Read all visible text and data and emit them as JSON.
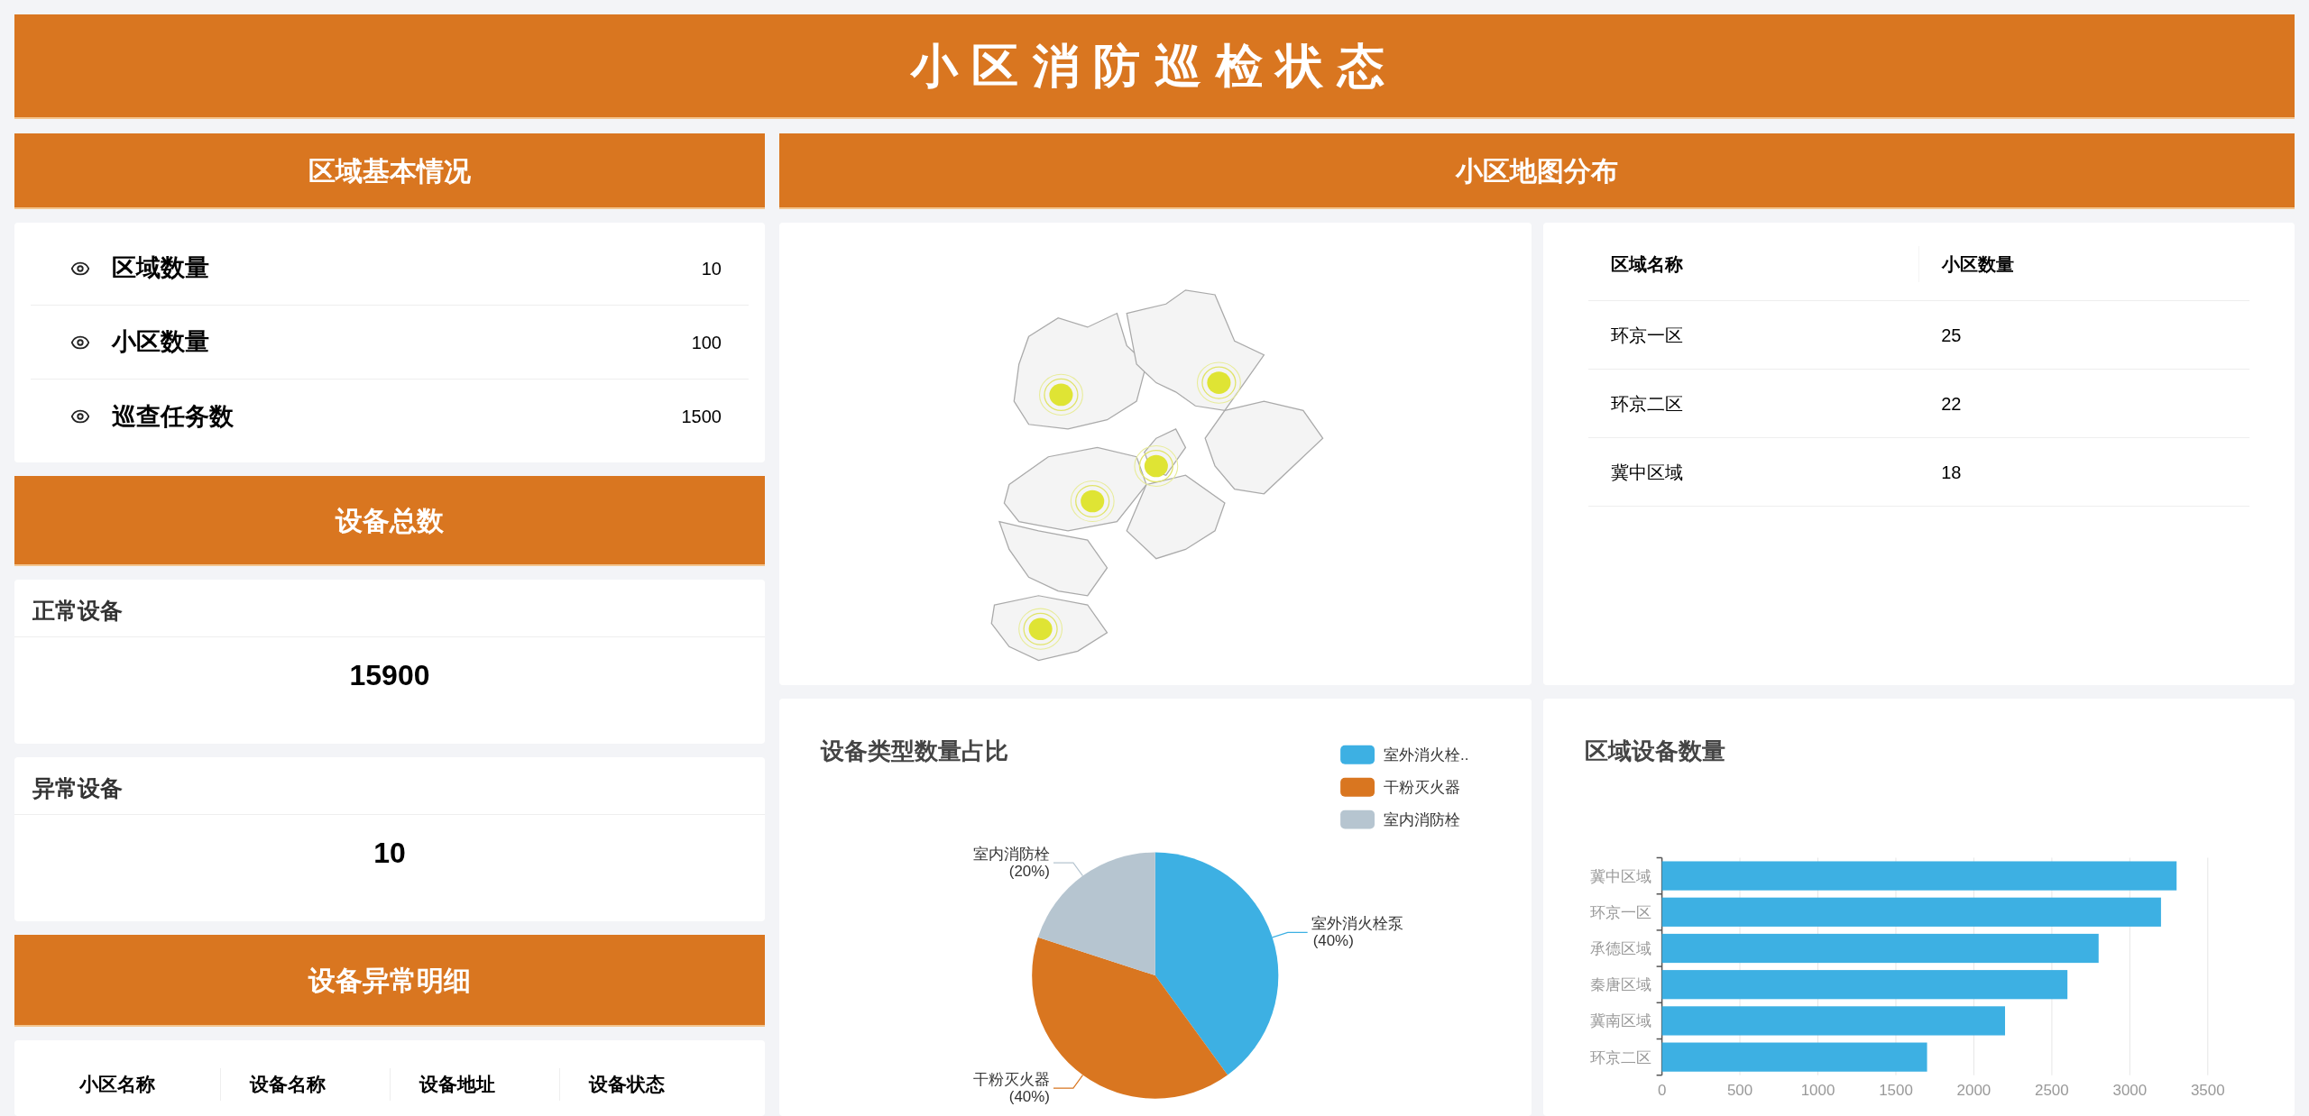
{
  "title": "小区消防巡检状态",
  "region_overview": {
    "header": "区域基本情况",
    "items": [
      {
        "label": "区域数量",
        "value": "10"
      },
      {
        "label": "小区数量",
        "value": "100"
      },
      {
        "label": "巡查任务数",
        "value": "1500"
      }
    ]
  },
  "device_total": {
    "header": "设备总数",
    "stats": [
      {
        "label": "正常设备",
        "value": "15900"
      },
      {
        "label": "异常设备",
        "value": "10"
      }
    ]
  },
  "device_anomalies": {
    "header": "设备异常明细",
    "columns": [
      "小区名称",
      "设备名称",
      "设备地址",
      "设备状态"
    ]
  },
  "map_section": {
    "header": "小区地图分布",
    "table": {
      "columns": [
        "区域名称",
        "小区数量"
      ],
      "rows": [
        [
          "环京一区",
          "25"
        ],
        [
          "环京二区",
          "22"
        ],
        [
          "冀中区域",
          "18"
        ]
      ]
    }
  },
  "device_type_share": {
    "legend": [
      {
        "label": "室外消火栓..",
        "color": "#3db0e3"
      },
      {
        "label": "干粉灭火器",
        "color": "#d97620"
      },
      {
        "label": "室内消防栓",
        "color": "#b6c5d0"
      }
    ],
    "chart_data": {
      "type": "pie",
      "title": "设备类型数量占比",
      "categories": [
        "室外消火栓泵",
        "干粉灭火器",
        "室内消防栓"
      ],
      "values": [
        40,
        40,
        20
      ],
      "value_labels": [
        "(40%)",
        "(40%)",
        "(20%)"
      ]
    }
  },
  "region_devices": {
    "chart_data": {
      "type": "bar",
      "orientation": "horizontal",
      "title": "区域设备数量",
      "categories": [
        "冀中区域",
        "环京一区",
        "承德区域",
        "秦唐区域",
        "冀南区域",
        "环京二区"
      ],
      "series": [
        {
          "color": "#3db0e3",
          "values": [
            3300,
            3200,
            2800,
            2600,
            2200,
            1700
          ]
        }
      ],
      "grid": true,
      "xlim": [
        0,
        3500
      ],
      "xticks": [
        0,
        500,
        1000,
        1500,
        2000,
        2500,
        3000,
        3500
      ]
    }
  }
}
